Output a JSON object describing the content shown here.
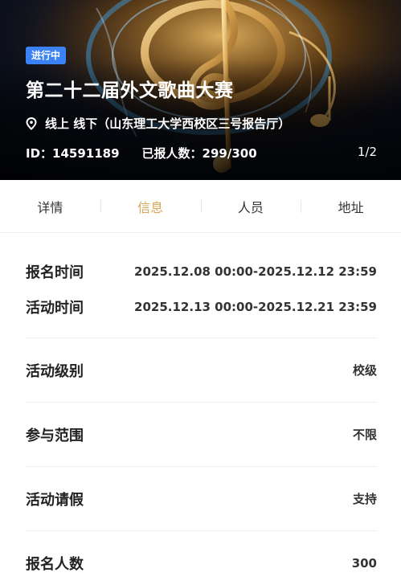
{
  "hero": {
    "status": "进行中",
    "title": "第二十二届外文歌曲大赛",
    "location": "线上 线下（山东理工大学西校区三号报告厅）",
    "id_text": "ID：14591189",
    "quota_text": "已报人数：299/300",
    "page_indicator": "1/2"
  },
  "tabs": [
    {
      "label": "详情"
    },
    {
      "label": "信息"
    },
    {
      "label": "人员"
    },
    {
      "label": "地址"
    }
  ],
  "info": {
    "signup_time": {
      "label": "报名时间",
      "value": "2025.12.08 00:00-2025.12.12 23:59"
    },
    "event_time": {
      "label": "活动时间",
      "value": "2025.12.13 00:00-2025.12.21 23:59"
    },
    "level": {
      "label": "活动级别",
      "value": "校级"
    },
    "scope": {
      "label": "参与范围",
      "value": "不限"
    },
    "leave": {
      "label": "活动请假",
      "value": "支持"
    },
    "count": {
      "label": "报名人数",
      "value": "300"
    }
  },
  "colors": {
    "accent": "#d9a55b",
    "badge": "#3b82f6"
  }
}
